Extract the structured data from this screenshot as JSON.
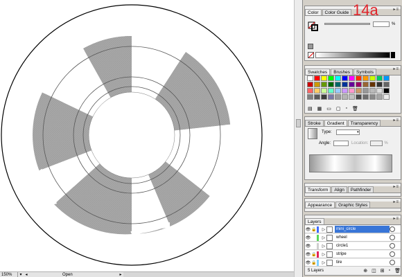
{
  "overlay": {
    "step_label": "14a"
  },
  "statusbar": {
    "zoom": "150%",
    "status": "Open"
  },
  "panels": {
    "color": {
      "tabs": [
        "Color",
        "Color Guide"
      ],
      "percent_value": "",
      "percent_symbol": "%"
    },
    "swatches": {
      "tabs": [
        "Swatches",
        "Brushes",
        "Symbols"
      ],
      "swatch_colors": [
        "#ffffff",
        "#ff0000",
        "#ffff00",
        "#00ff00",
        "#00ffff",
        "#0000ff",
        "#ff00ff",
        "#ff3300",
        "#ff9900",
        "#ccff00",
        "#00cc66",
        "#0099ff",
        "#cc0000",
        "#cc9900",
        "#669900",
        "#006600",
        "#006666",
        "#003399",
        "#660099",
        "#990066",
        "#996633",
        "#663300",
        "#333333",
        "#666666",
        "#ff6666",
        "#ffcc66",
        "#ccff99",
        "#66ffcc",
        "#99ccff",
        "#cc99ff",
        "#ff99cc",
        "#cc9966",
        "#999999",
        "#bbbbbb",
        "#dddddd",
        "#000000",
        "#808080",
        "#5a5a5a",
        "#3c3c3c",
        "#7a7aa8",
        "#9b9b9b",
        "#b5b5b5",
        "#c2c2c2",
        "#4a4a4a",
        "#6e6e6e",
        "#8a8a8a",
        "#a7a7a7",
        "#ececec"
      ]
    },
    "gradient": {
      "tabs": [
        "Stroke",
        "Gradient",
        "Transparency"
      ],
      "type_label": "Type:",
      "angle_label": "Angle:",
      "location_label": "Location:",
      "location_unit": "%"
    },
    "transform": {
      "tabs": [
        "Transform",
        "Align",
        "Pathfinder"
      ]
    },
    "appearance": {
      "tabs": [
        "Appearance",
        "Graphic Styles"
      ]
    },
    "layers": {
      "tabs": [
        "Layers"
      ],
      "rows": [
        {
          "name": "mini_circle",
          "color": "#3f6bff",
          "selected": true
        },
        {
          "name": "wheel",
          "color": "#5ad85a",
          "selected": false
        },
        {
          "name": "circle1",
          "color": "#cfcfcf",
          "selected": false
        },
        {
          "name": "stripe",
          "color": "#e0245a",
          "selected": false
        },
        {
          "name": "tire",
          "color": "#7fd0ff",
          "selected": false
        }
      ],
      "count_label": "5 Layers"
    }
  }
}
